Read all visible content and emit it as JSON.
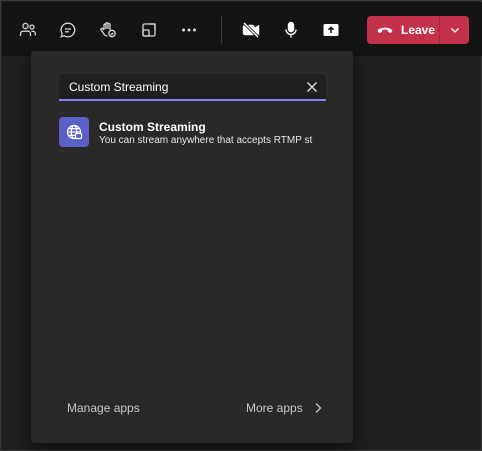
{
  "toolbar": {
    "buttons": [
      {
        "icon": "people-icon"
      },
      {
        "icon": "chat-icon"
      },
      {
        "icon": "raise-hand-icon"
      },
      {
        "icon": "share-tray-icon"
      },
      {
        "icon": "more-options-icon"
      },
      {
        "icon": "camera-off-icon"
      },
      {
        "icon": "microphone-icon"
      },
      {
        "icon": "share-screen-icon"
      }
    ],
    "leave_label": "Leave",
    "leave_color": "#c4314b"
  },
  "flyout": {
    "search": {
      "value": "Custom Streaming",
      "placeholder": "Search"
    },
    "results": [
      {
        "name": "Custom Streaming",
        "description": "You can stream anywhere that accepts RTMP st",
        "icon": "globe-stream-icon"
      }
    ],
    "footer": {
      "manage_apps": "Manage apps",
      "more_apps": "More apps"
    }
  },
  "colors": {
    "accent": "#7f85f5",
    "app_icon_bg": "#5b5fc7"
  }
}
